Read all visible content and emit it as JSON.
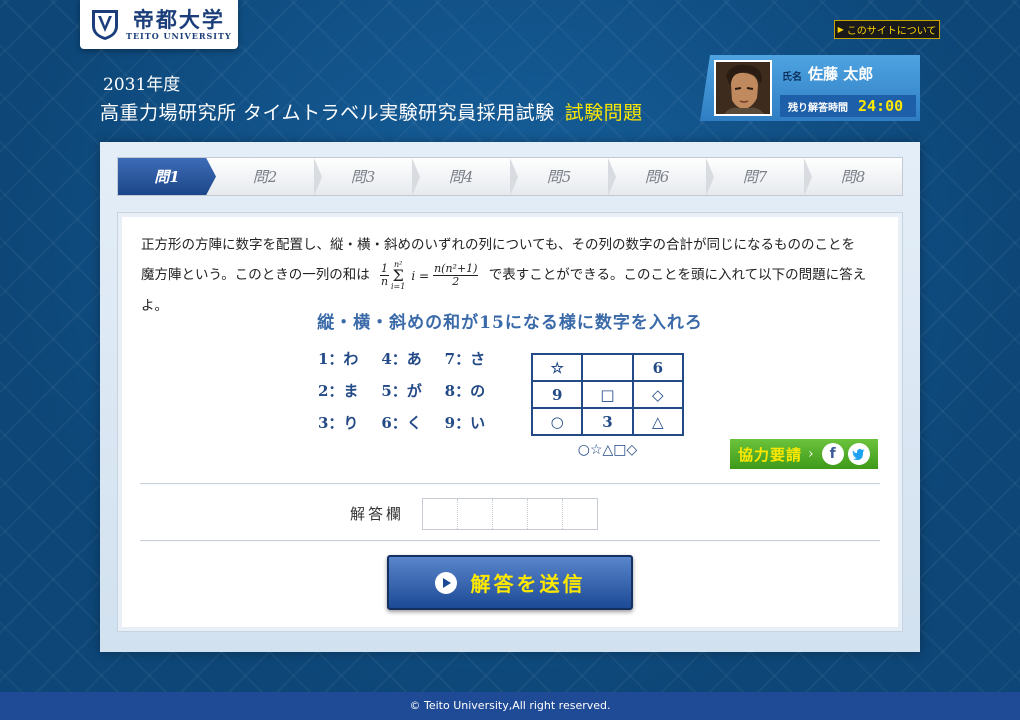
{
  "header": {
    "logo_name": "帝都大学",
    "logo_sub": "TEITO UNIVERSITY",
    "about_label": "このサイトについて",
    "year": "2031年度",
    "exam_title": "高重力場研究所 タイムトラベル実験研究員採用試験",
    "exam_highlight": "試験問題"
  },
  "user": {
    "name_label": "氏名",
    "name": "佐藤 太郎",
    "timer_label": "残り解答時間",
    "timer": "24:00"
  },
  "tabs": [
    {
      "label": "問1",
      "active": true
    },
    {
      "label": "問2"
    },
    {
      "label": "問3"
    },
    {
      "label": "問4"
    },
    {
      "label": "問5"
    },
    {
      "label": "問6"
    },
    {
      "label": "問7"
    },
    {
      "label": "問8"
    }
  ],
  "question": {
    "intro_1": "正方形の方陣に数字を配置し、縦・横・斜めのいずれの列についても、その列の数字の合計が同じになるもののことを",
    "intro_2a": "魔方陣という。このときの一列の和は",
    "intro_2b": "で表すことができる。このことを頭に入れて以下の問題に答えよ。",
    "formula": {
      "frac1_num": "1",
      "frac1_den": "n",
      "sum_top": "n²",
      "sum_sym": "Σ",
      "sum_bottom": "i=1",
      "var": "i =",
      "frac2_num": "n(n²+1)",
      "frac2_den": "2"
    },
    "heading": "縦・横・斜めの和が15になる様に数字を入れろ",
    "key": [
      "1：わ",
      "4：あ",
      "7：さ",
      "2：ま",
      "5：が",
      "8：の",
      "3：り",
      "6：く",
      "9：い"
    ],
    "grid": [
      "☆",
      "",
      "6",
      "9",
      "□",
      "◇",
      "○",
      "3",
      "△"
    ],
    "answer_shapes": "○☆△□◇"
  },
  "coop": {
    "label": "協力要請",
    "chevron": "›",
    "fb": "f",
    "tw": "t"
  },
  "answer": {
    "label": "解答欄",
    "cells": 5
  },
  "submit": {
    "label": "解答を送信"
  },
  "footer": {
    "copyright": "© Teito University,All right reserved."
  },
  "colors": {
    "background": "#0f4a7e",
    "accent_yellow": "#ffe800",
    "primary_blue": "#1d4a95",
    "coop_green": "#4fae26"
  }
}
